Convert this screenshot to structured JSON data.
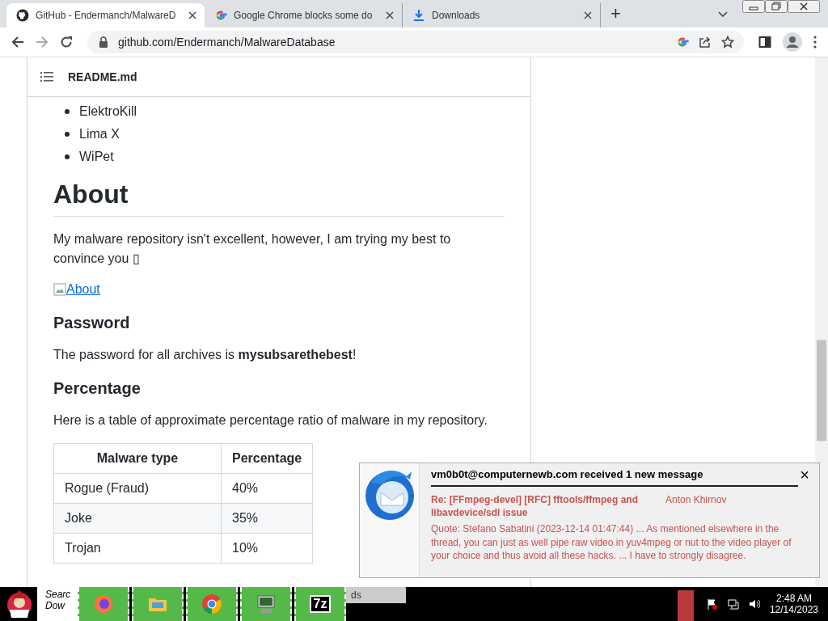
{
  "browser": {
    "tabs": [
      {
        "title": "GitHub - Endermanch/MalwareD",
        "selected": true
      },
      {
        "title": "Google Chrome blocks some do",
        "selected": false
      },
      {
        "title": "Downloads",
        "selected": false
      }
    ],
    "new_tab": "+",
    "address": "github.com/Endermanch/MalwareDatabase"
  },
  "readme": {
    "title": "README.md",
    "blocks": [
      {
        "kind": "bullets",
        "items": [
          "ElektroKill",
          "Lima X",
          "WiPet"
        ]
      },
      {
        "kind": "h1",
        "text": "About"
      },
      {
        "kind": "p",
        "text": "My malware repository isn't excellent, however, I am trying my best to convince you ▯"
      },
      {
        "kind": "image_link",
        "text": "About"
      },
      {
        "kind": "h3",
        "text": "Password"
      },
      {
        "kind": "p",
        "text": "The password for all archives is **mysubsarethebest**!"
      },
      {
        "kind": "h3",
        "text": "Percentage"
      },
      {
        "kind": "p",
        "text": "Here is a table of approximate percentage ratio of malware in my repository."
      },
      {
        "kind": "table",
        "columns": [
          "Malware type",
          "Percentage"
        ],
        "rows": [
          [
            "Rogue (Fraud)",
            "40%"
          ],
          [
            "Joke",
            "35%"
          ],
          [
            "Trojan",
            "10%"
          ]
        ]
      }
    ]
  },
  "notification": {
    "title": "vm0b0t@computernewb.com received 1 new message",
    "close": "×",
    "subject": "Re: [FFmpeg-devel] [RFC] fftools/ffmpeg and libavdevice/sdl issue",
    "sender": "Anton Khirnov",
    "preview": "Quote: Stefano Sabatini (2023-12-14 01:47:44) ... As mentioned elsewhere in the thread, you can just as well pipe raw video in yuv4mpeg or nut to the video player of your choice and thus avoid all these hacks. ... I have to strongly disagree."
  },
  "taskbar": {
    "search": [
      "Searc",
      "Dow"
    ],
    "window_label": "ds",
    "archiver_label": "7z",
    "time": "2:48 AM",
    "date": "12/14/2023"
  }
}
